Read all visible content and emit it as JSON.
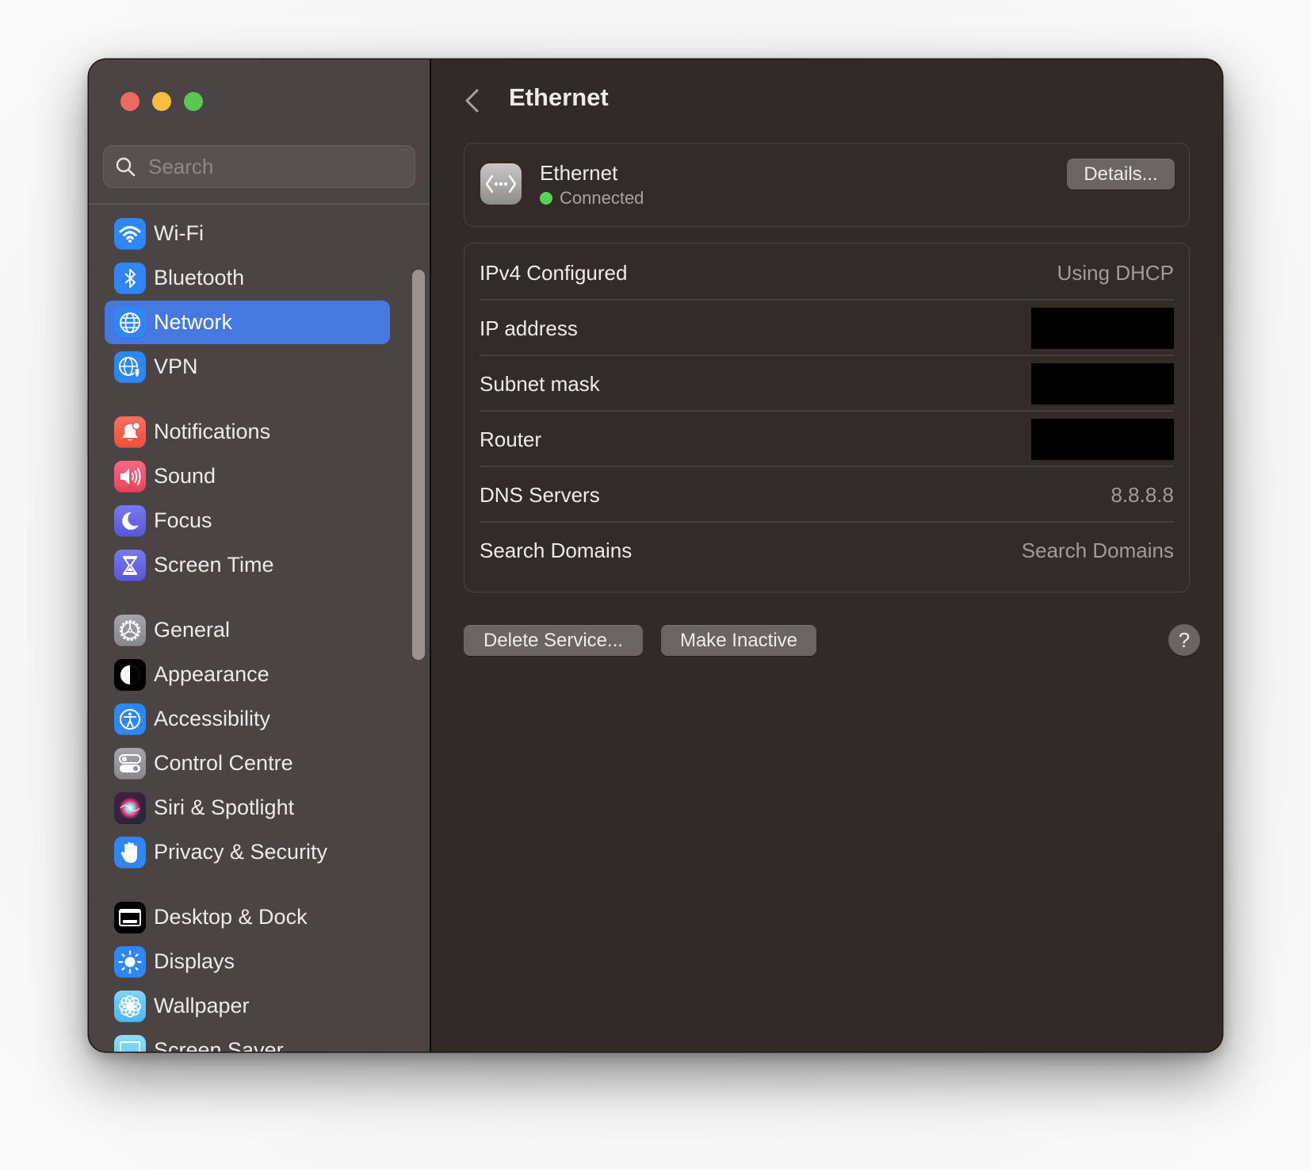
{
  "window": {
    "title": "Ethernet",
    "traffic_lights": [
      "close",
      "minimize",
      "zoom"
    ]
  },
  "sidebar": {
    "search_placeholder": "Search",
    "search_value": "",
    "groups": [
      [
        {
          "label": "Wi-Fi",
          "icon": "wifi-icon",
          "color": "#2f86f6"
        },
        {
          "label": "Bluetooth",
          "icon": "bluetooth-icon",
          "color": "#2f86f6"
        },
        {
          "label": "Network",
          "icon": "globe-icon",
          "color": "#2f86f6",
          "active": true
        },
        {
          "label": "VPN",
          "icon": "vpn-globe-shield-icon",
          "color": "#2f86f6"
        }
      ],
      [
        {
          "label": "Notifications",
          "icon": "bell-icon",
          "color": "#f05a46"
        },
        {
          "label": "Sound",
          "icon": "speaker-icon",
          "color": "#ee4a68"
        },
        {
          "label": "Focus",
          "icon": "moon-icon",
          "color": "#5e5ce6"
        },
        {
          "label": "Screen Time",
          "icon": "hourglass-icon",
          "color": "#5e5ce6"
        }
      ],
      [
        {
          "label": "General",
          "icon": "gear-icon",
          "color": "#8e8e93"
        },
        {
          "label": "Appearance",
          "icon": "appearance-icon",
          "color": "#000000"
        },
        {
          "label": "Accessibility",
          "icon": "accessibility-icon",
          "color": "#2f86f6"
        },
        {
          "label": "Control Centre",
          "icon": "toggles-icon",
          "color": "#8e8e93"
        },
        {
          "label": "Siri & Spotlight",
          "icon": "siri-icon",
          "color": "#3a1b3c"
        },
        {
          "label": "Privacy & Security",
          "icon": "hand-icon",
          "color": "#2f86f6"
        }
      ],
      [
        {
          "label": "Desktop & Dock",
          "icon": "dock-icon",
          "color": "#000000"
        },
        {
          "label": "Displays",
          "icon": "sun-icon",
          "color": "#2f86f6"
        },
        {
          "label": "Wallpaper",
          "icon": "flower-icon",
          "color": "#5ac8fa"
        },
        {
          "label": "Screen Saver",
          "icon": "screensaver-icon",
          "color": "#5ac8fa"
        }
      ]
    ]
  },
  "main": {
    "back_icon": "chevron-left-icon",
    "title": "Ethernet",
    "service": {
      "name": "Ethernet",
      "status": "Connected",
      "status_color": "#5ad15a",
      "details_label": "Details..."
    },
    "info_rows": [
      {
        "label": "IPv4 Configured",
        "value": "Using DHCP",
        "redacted": false
      },
      {
        "label": "IP address",
        "value": "",
        "redacted": true
      },
      {
        "label": "Subnet mask",
        "value": "",
        "redacted": true
      },
      {
        "label": "Router",
        "value": "",
        "redacted": true
      },
      {
        "label": "DNS Servers",
        "value": "8.8.8.8",
        "redacted": false
      },
      {
        "label": "Search Domains",
        "value": "Search Domains",
        "redacted": false
      }
    ],
    "buttons": {
      "delete_service": "Delete Service...",
      "make_inactive": "Make Inactive",
      "help": "?"
    }
  }
}
